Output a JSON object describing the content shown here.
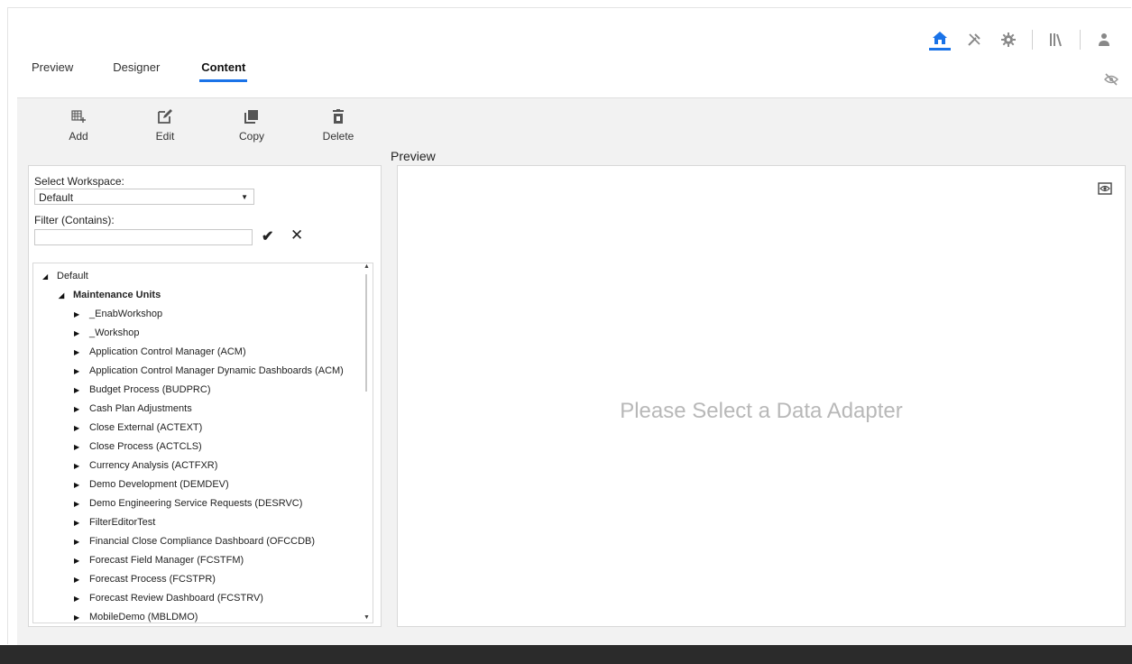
{
  "header": {
    "icons": [
      "home-icon",
      "tools-icon",
      "gear-icon",
      "library-icon",
      "user-icon"
    ],
    "accent_color": "#1a73e8"
  },
  "tabs": [
    {
      "label": "Preview"
    },
    {
      "label": "Designer"
    },
    {
      "label": "Content",
      "active": true
    }
  ],
  "toolbar": {
    "add_label": "Add",
    "edit_label": "Edit",
    "copy_label": "Copy",
    "delete_label": "Delete"
  },
  "preview_panel": {
    "title": "Preview",
    "empty_message": "Please Select a Data Adapter"
  },
  "workspace": {
    "label": "Select Workspace:",
    "selected": "Default"
  },
  "filter": {
    "label": "Filter (Contains):",
    "value": ""
  },
  "tree": {
    "root": "Default",
    "group": "Maintenance Units",
    "items": [
      "_EnabWorkshop",
      "_Workshop",
      "Application Control Manager (ACM)",
      "Application Control Manager Dynamic Dashboards (ACM)",
      "Budget Process (BUDPRC)",
      "Cash Plan Adjustments",
      "Close External (ACTEXT)",
      "Close Process (ACTCLS)",
      "Currency Analysis (ACTFXR)",
      "Demo Development (DEMDEV)",
      "Demo Engineering Service Requests (DESRVC)",
      "FilterEditorTest",
      "Financial Close Compliance Dashboard (OFCCDB)",
      "Forecast Field Manager (FCSTFM)",
      "Forecast Process (FCSTPR)",
      "Forecast Review Dashboard (FCSTRV)",
      "MobileDemo (MBLDMO)"
    ]
  }
}
